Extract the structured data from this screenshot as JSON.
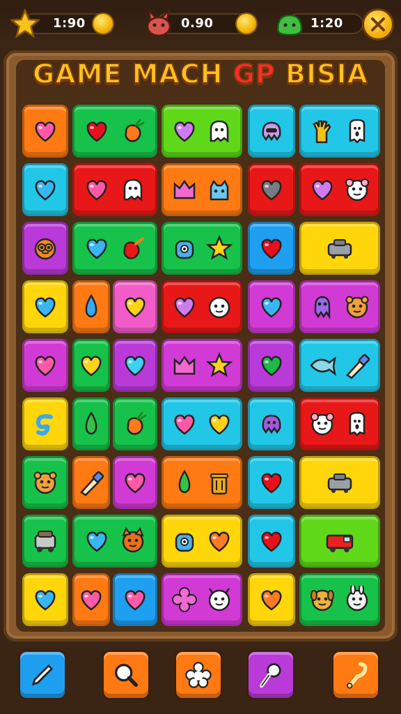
{
  "hud": {
    "stats": [
      {
        "name": "star",
        "value": "1:90",
        "icon": "star-icon",
        "color": "#f7c21a"
      },
      {
        "name": "creature",
        "value": "0.90",
        "icon": "creature-icon",
        "color": "#d9534f"
      },
      {
        "name": "slime",
        "value": "1:20",
        "icon": "slime-icon",
        "color": "#3fbf3f"
      }
    ],
    "coin_icon": "coin-icon",
    "close_icon": "close-icon"
  },
  "title": {
    "part1": "GAME MACH ",
    "part2": "GP",
    "part3": " BISIA"
  },
  "colors": {
    "orange": "#ff7a12",
    "green": "#17c24a",
    "lime": "#5fd81a",
    "cyan": "#22c7e8",
    "red": "#e81818",
    "purple": "#b93ad8",
    "magenta": "#d23ad6",
    "yellow": "#ffd60a",
    "blue": "#1e9ff0",
    "pink": "#f25cc8"
  },
  "board": {
    "tiles": [
      {
        "color": "orange",
        "icons": [
          "pink-heart-icon"
        ]
      },
      {
        "color": "green",
        "icons": [
          "red-heart-icon",
          "orange-carrot-icon"
        ]
      },
      {
        "color": "lime",
        "icons": [
          "purple-heart-icon",
          "ghost-icon"
        ]
      },
      {
        "color": "cyan",
        "icons": [
          "pink-octopus-icon"
        ]
      },
      {
        "color": "cyan",
        "icons": [
          "glove-icon",
          "tooth-icon"
        ]
      },
      {
        "color": "cyan",
        "icons": [
          "blue-heart-icon"
        ]
      },
      {
        "color": "red",
        "icons": [
          "pink-heart-icon",
          "ghost-icon"
        ]
      },
      {
        "color": "orange",
        "icons": [
          "pink-crown-icon",
          "blue-cat-icon"
        ]
      },
      {
        "color": "red",
        "icons": [
          "gray-heart-icon"
        ]
      },
      {
        "color": "red",
        "icons": [
          "purple-heart-icon",
          "mouse-icon"
        ]
      },
      {
        "color": "purple",
        "icons": [
          "owl-icon"
        ]
      },
      {
        "color": "green",
        "icons": [
          "blue-heart-icon",
          "red-carrot-icon"
        ]
      },
      {
        "color": "green",
        "icons": [
          "robot-icon",
          "yellow-star-icon"
        ]
      },
      {
        "color": "blue",
        "icons": [
          "red-heart-icon"
        ]
      },
      {
        "color": "yellow",
        "icons": [
          "tank-icon"
        ]
      },
      {
        "color": "yellow",
        "icons": [
          "blue-heart-icon"
        ]
      },
      {
        "color": "orange",
        "icons": [
          "blue-drop-icon"
        ]
      },
      {
        "color": "pink",
        "icons": [
          "yellow-heart-icon"
        ]
      },
      {
        "color": "red",
        "icons": [
          "purple-heart-icon",
          "face-icon"
        ]
      },
      {
        "color": "magenta",
        "icons": [
          "blue-heart-icon"
        ]
      },
      {
        "color": "magenta",
        "icons": [
          "squid-icon",
          "bear-icon"
        ]
      },
      {
        "color": "magenta",
        "icons": [
          "pink-heart-icon"
        ]
      },
      {
        "color": "green",
        "icons": [
          "yellow-heart-icon"
        ]
      },
      {
        "color": "purple",
        "icons": [
          "cyan-heart-icon"
        ]
      },
      {
        "color": "magenta",
        "icons": [
          "pink-crown-icon",
          "yellow-star-icon"
        ]
      },
      {
        "color": "purple",
        "icons": [
          "green-heart-icon"
        ]
      },
      {
        "color": "cyan",
        "icons": [
          "fish-icon",
          "brush-icon"
        ]
      },
      {
        "color": "yellow",
        "icons": [
          "blue-swirl-icon"
        ]
      },
      {
        "color": "green",
        "icons": [
          "green-drop-icon"
        ]
      },
      {
        "color": "green",
        "icons": [
          "orange-carrot-icon"
        ]
      },
      {
        "color": "cyan",
        "icons": [
          "pink-heart-icon",
          "yellow-heart-icon"
        ]
      },
      {
        "color": "cyan",
        "icons": [
          "purple-octopus-icon"
        ]
      },
      {
        "color": "red",
        "icons": [
          "mouse-icon",
          "tooth-icon"
        ]
      },
      {
        "color": "green",
        "icons": [
          "bear-icon"
        ]
      },
      {
        "color": "orange",
        "icons": [
          "brush-icon"
        ]
      },
      {
        "color": "magenta",
        "icons": [
          "pink-heart-icon"
        ]
      },
      {
        "color": "orange",
        "icons": [
          "green-drop-icon",
          "trash-icon"
        ]
      },
      {
        "color": "cyan",
        "icons": [
          "red-heart-icon"
        ]
      },
      {
        "color": "yellow",
        "icons": [
          "tank-icon"
        ]
      },
      {
        "color": "green",
        "icons": [
          "robot-car-icon"
        ]
      },
      {
        "color": "green",
        "icons": [
          "blue-heart-icon",
          "fox-icon"
        ]
      },
      {
        "color": "yellow",
        "icons": [
          "robot-icon",
          "orange-heart-icon"
        ]
      },
      {
        "color": "cyan",
        "icons": [
          "red-heart-icon"
        ]
      },
      {
        "color": "lime",
        "icons": [
          "firetruck-icon"
        ]
      },
      {
        "color": "yellow",
        "icons": [
          "blue-heart-icon"
        ]
      },
      {
        "color": "orange",
        "icons": [
          "pink-heart-icon"
        ]
      },
      {
        "color": "blue",
        "icons": [
          "pink-heart-icon"
        ]
      },
      {
        "color": "magenta",
        "icons": [
          "pink-flower-icon",
          "goat-icon"
        ]
      },
      {
        "color": "yellow",
        "icons": [
          "orange-heart-icon"
        ]
      },
      {
        "color": "green",
        "icons": [
          "dog-icon",
          "rabbit-icon"
        ]
      }
    ]
  },
  "tools": [
    {
      "name": "pencil-tool",
      "color": "blue",
      "icon": "pencil-icon"
    },
    {
      "name": "search-tool",
      "color": "orange",
      "icon": "magnifier-icon"
    },
    {
      "name": "shuffle-tool",
      "color": "orange",
      "icon": "flower-icon"
    },
    {
      "name": "pin-tool",
      "color": "purple",
      "icon": "pin-icon"
    },
    {
      "name": "hook-tool",
      "color": "orange",
      "icon": "hook-icon"
    }
  ]
}
